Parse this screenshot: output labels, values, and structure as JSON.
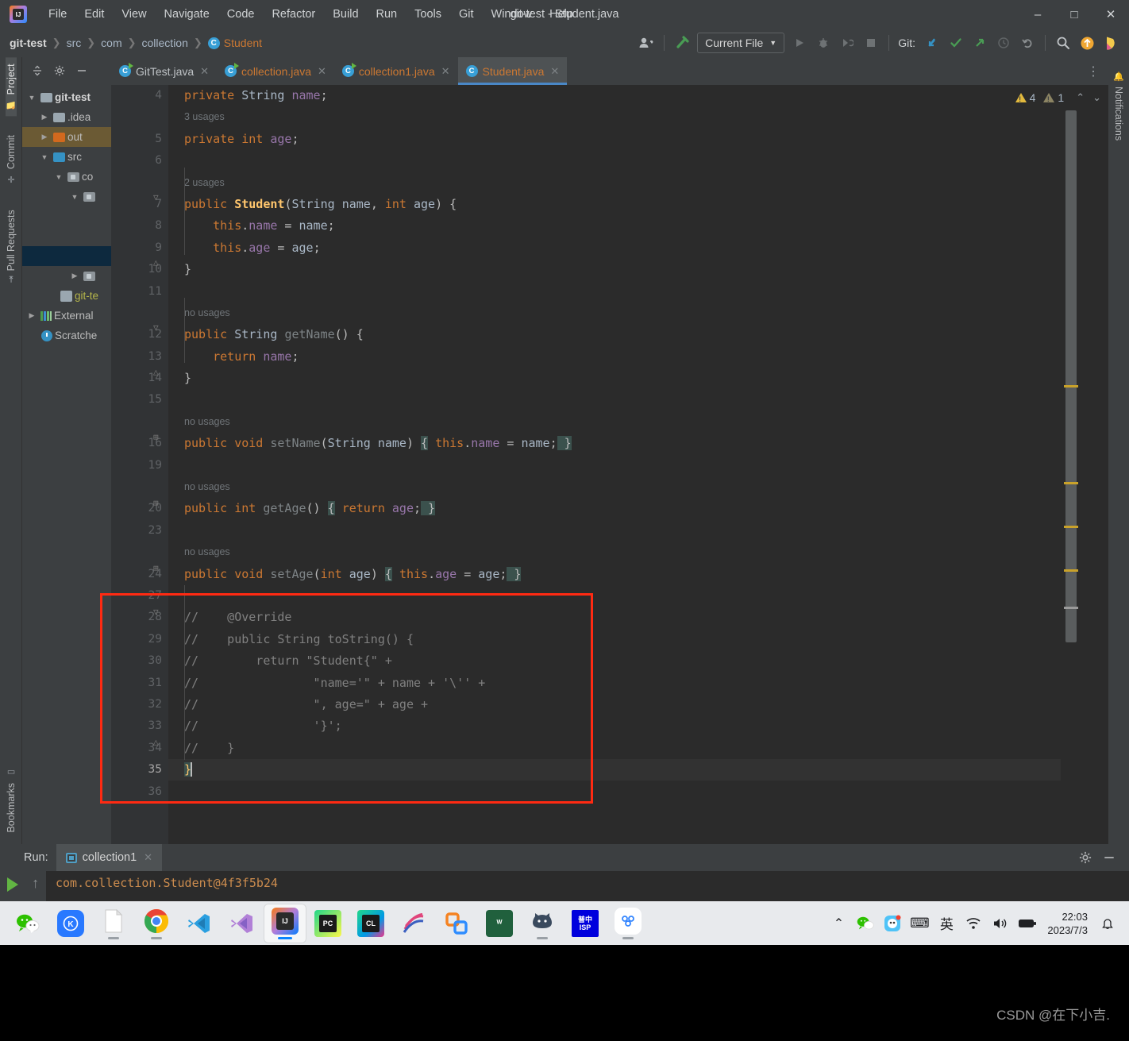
{
  "window": {
    "title": "git-test - Student.java",
    "minimize": "–",
    "maximize": "□",
    "close": "✕"
  },
  "menubar": {
    "items": [
      "File",
      "Edit",
      "View",
      "Navigate",
      "Code",
      "Refactor",
      "Build",
      "Run",
      "Tools",
      "Git",
      "Window",
      "Help"
    ]
  },
  "breadcrumb": {
    "items": [
      "git-test",
      "src",
      "com",
      "collection",
      "Student"
    ],
    "separator": "❯",
    "class_badge": "C"
  },
  "toolbar": {
    "run_config": "Current File",
    "git_label": "Git:",
    "icons": [
      "user-avatar-icon",
      "build-hammer-icon",
      "run-icon",
      "debug-icon",
      "run-coverage-icon",
      "stop-icon",
      "git-update-icon",
      "git-commit-icon",
      "git-push-icon",
      "git-history-icon",
      "git-rollback-icon",
      "search-everywhere-icon",
      "ide-update-icon",
      "ide-assistant-icon"
    ]
  },
  "left_tool_window_tabs": [
    {
      "label": "Project",
      "icon": "project-folder-icon",
      "active": true
    },
    {
      "label": "Commit",
      "icon": "commit-icon",
      "active": false
    },
    {
      "label": "Pull Requests",
      "icon": "pull-request-icon",
      "active": false
    }
  ],
  "bottom_tool_window_tabs": [
    {
      "label": "Bookmarks",
      "icon": "bookmark-icon"
    }
  ],
  "right_tool_window_tabs": [
    {
      "label": "Notifications",
      "icon": "notification-bell-icon"
    }
  ],
  "project_tree": [
    {
      "label": "git-test",
      "indent": 0,
      "arrow": "▾",
      "icon": "module-folder-icon",
      "bold": true,
      "state": "normal"
    },
    {
      "label": ".idea",
      "indent": 1,
      "arrow": "›",
      "icon": "folder-grey-icon",
      "bold": false,
      "state": "normal"
    },
    {
      "label": "out",
      "indent": 1,
      "arrow": "›",
      "icon": "folder-orange-icon",
      "bold": false,
      "state": "highlight-orange"
    },
    {
      "label": "src",
      "indent": 1,
      "arrow": "▾",
      "icon": "folder-blue-icon",
      "bold": false,
      "state": "normal"
    },
    {
      "label": "co",
      "indent": 2,
      "arrow": "▾",
      "icon": "package-icon",
      "bold": false,
      "state": "normal"
    },
    {
      "label": "",
      "indent": 3,
      "arrow": "▾",
      "icon": "package-icon",
      "bold": false,
      "state": "normal"
    },
    {
      "label": "",
      "indent": 3,
      "arrow": "",
      "icon": "",
      "bold": false,
      "state": "normal"
    },
    {
      "label": "",
      "indent": 3,
      "arrow": "",
      "icon": "",
      "bold": false,
      "state": "selected-blue"
    },
    {
      "label": "",
      "indent": 3,
      "arrow": "›",
      "icon": "package-icon",
      "bold": false,
      "state": "normal"
    },
    {
      "label": "git-te",
      "indent": 2,
      "arrow": "",
      "icon": "iml-file-icon",
      "bold": false,
      "state": "yellow"
    },
    {
      "label": "External",
      "indent": 0,
      "arrow": "›",
      "icon": "external-libraries-icon",
      "bold": false,
      "state": "normal"
    },
    {
      "label": "Scratche",
      "indent": 1,
      "arrow": "",
      "icon": "scratches-icon",
      "bold": false,
      "state": "normal"
    }
  ],
  "editor_tabs": [
    {
      "label": "GitTest.java",
      "icon": "java-runnable-class-icon",
      "active": false,
      "modified_color": "#bfc3c6"
    },
    {
      "label": "collection.java",
      "icon": "java-runnable-class-icon",
      "active": false,
      "modified_color": "#cc7832"
    },
    {
      "label": "collection1.java",
      "icon": "java-runnable-class-icon",
      "active": false,
      "modified_color": "#cc7832"
    },
    {
      "label": "Student.java",
      "icon": "java-class-icon",
      "active": true,
      "modified_color": "#cc7832"
    }
  ],
  "editor_toolbar": {
    "collapse_all_icon": "collapse-all-icon",
    "settings_icon": "gear-icon",
    "hide_icon": "minimize-icon",
    "more_icon": "more-vertical-icon"
  },
  "inspection_widget": {
    "warning_count": "4",
    "weak_warning_count": "1",
    "prev_label": "⌃",
    "next_label": "⌄"
  },
  "code": {
    "lines": [
      {
        "num": "4",
        "hint": "",
        "text": "private String name;",
        "fold": "",
        "type": "code"
      },
      {
        "num": "",
        "hint": "3 usages",
        "text": "",
        "fold": "",
        "type": "hint"
      },
      {
        "num": "5",
        "hint": "",
        "text": "private int age;",
        "fold": "",
        "type": "code"
      },
      {
        "num": "6",
        "hint": "",
        "text": "",
        "fold": "",
        "type": "code"
      },
      {
        "num": "",
        "hint": "2 usages",
        "text": "",
        "fold": "",
        "type": "hint"
      },
      {
        "num": "7",
        "hint": "",
        "text": "public Student(String name, int age) {",
        "fold": "▽",
        "type": "code"
      },
      {
        "num": "8",
        "hint": "",
        "text": "    this.name = name;",
        "fold": "",
        "type": "code"
      },
      {
        "num": "9",
        "hint": "",
        "text": "    this.age = age;",
        "fold": "",
        "type": "code"
      },
      {
        "num": "10",
        "hint": "",
        "text": "}",
        "fold": "△",
        "type": "code"
      },
      {
        "num": "11",
        "hint": "",
        "text": "",
        "fold": "",
        "type": "code"
      },
      {
        "num": "",
        "hint": "no usages",
        "text": "",
        "fold": "",
        "type": "hint"
      },
      {
        "num": "12",
        "hint": "",
        "text": "public String getName() {",
        "fold": "▽",
        "type": "code"
      },
      {
        "num": "13",
        "hint": "",
        "text": "    return name;",
        "fold": "",
        "type": "code"
      },
      {
        "num": "14",
        "hint": "",
        "text": "}",
        "fold": "△",
        "type": "code"
      },
      {
        "num": "15",
        "hint": "",
        "text": "",
        "fold": "",
        "type": "code"
      },
      {
        "num": "",
        "hint": "no usages",
        "text": "",
        "fold": "",
        "type": "hint"
      },
      {
        "num": "16",
        "hint": "",
        "text": "public void setName(String name) { this.name = name; }",
        "fold": "⊞",
        "type": "code"
      },
      {
        "num": "19",
        "hint": "",
        "text": "",
        "fold": "",
        "type": "code"
      },
      {
        "num": "",
        "hint": "no usages",
        "text": "",
        "fold": "",
        "type": "hint"
      },
      {
        "num": "20",
        "hint": "",
        "text": "public int getAge() { return age; }",
        "fold": "⊞",
        "type": "code"
      },
      {
        "num": "23",
        "hint": "",
        "text": "",
        "fold": "",
        "type": "code"
      },
      {
        "num": "",
        "hint": "no usages",
        "text": "",
        "fold": "",
        "type": "hint"
      },
      {
        "num": "24",
        "hint": "",
        "text": "public void setAge(int age) { this.age = age; }",
        "fold": "⊞",
        "type": "code"
      },
      {
        "num": "27",
        "hint": "",
        "text": "",
        "fold": "",
        "type": "code"
      },
      {
        "num": "28",
        "hint": "",
        "text": "//    @Override",
        "fold": "▽",
        "type": "comment"
      },
      {
        "num": "29",
        "hint": "",
        "text": "//    public String toString() {",
        "fold": "",
        "type": "comment"
      },
      {
        "num": "30",
        "hint": "",
        "text": "//        return \"Student{\" +",
        "fold": "",
        "type": "comment"
      },
      {
        "num": "31",
        "hint": "",
        "text": "//                \"name='\" + name + '\\'' +",
        "fold": "",
        "type": "comment"
      },
      {
        "num": "32",
        "hint": "",
        "text": "//                \", age=\" + age +",
        "fold": "",
        "type": "comment"
      },
      {
        "num": "33",
        "hint": "",
        "text": "//                '}';",
        "fold": "",
        "type": "comment"
      },
      {
        "num": "34",
        "hint": "",
        "text": "//    }",
        "fold": "△",
        "type": "comment"
      },
      {
        "num": "35",
        "hint": "",
        "text": "}",
        "fold": "",
        "type": "caret"
      },
      {
        "num": "36",
        "hint": "",
        "text": "",
        "fold": "",
        "type": "code"
      }
    ]
  },
  "run_panel": {
    "label": "Run:",
    "tab": "collection1",
    "tab_close": "✕",
    "settings_icon": "gear-icon",
    "hide_icon": "minimize-icon",
    "output": "com.collection.Student@4f3f5b24",
    "rerun_icon": "rerun-green-play-icon",
    "scroll_up_icon": "scroll-up-icon"
  },
  "taskbar": {
    "apps": [
      {
        "name": "wechat-icon",
        "label": "",
        "color": "#2dc100",
        "glyph": "",
        "dot": false,
        "active": false
      },
      {
        "name": "kugou-icon",
        "label": "K",
        "color": "#2979ff",
        "glyph": "K",
        "dot": false,
        "active": false
      },
      {
        "name": "file-explorer-icon",
        "label": "",
        "color": "#ffffff",
        "glyph": "",
        "dot": true,
        "active": false
      },
      {
        "name": "chrome-icon",
        "label": "",
        "color": "#ea4335",
        "glyph": "",
        "dot": true,
        "active": false
      },
      {
        "name": "vscode-icon",
        "label": "",
        "color": "#1f9cf0",
        "glyph": "",
        "dot": false,
        "active": false
      },
      {
        "name": "visual-studio-icon",
        "label": "",
        "color": "#8661c5",
        "glyph": "",
        "dot": false,
        "active": false
      },
      {
        "name": "intellij-idea-icon",
        "label": "IJ",
        "color": "#2b2b2b",
        "glyph": "IJ",
        "dot": true,
        "active": true
      },
      {
        "name": "pycharm-icon",
        "label": "PC",
        "color": "#21d789",
        "glyph": "PC",
        "dot": false,
        "active": false
      },
      {
        "name": "clion-icon",
        "label": "CL",
        "color": "#21d789",
        "glyph": "CL",
        "dot": false,
        "active": false
      },
      {
        "name": "navicat-icon",
        "label": "",
        "color": "#e0457b",
        "glyph": "",
        "dot": false,
        "active": false
      },
      {
        "name": "vmware-icon",
        "label": "",
        "color": "#f58220",
        "glyph": "",
        "dot": false,
        "active": false
      },
      {
        "name": "vmware-workstation-icon",
        "label": "W",
        "color": "#20603d",
        "glyph": "W",
        "dot": false,
        "active": false
      },
      {
        "name": "gitkraken-cat-icon",
        "label": "",
        "color": "#3a4a5e",
        "glyph": "",
        "dot": true,
        "active": false
      },
      {
        "name": "isp-icon",
        "label": "ISP",
        "color": "#0000dd",
        "glyph": "ISP",
        "dot": false,
        "active": false
      },
      {
        "name": "baidu-netdisk-icon",
        "label": "",
        "color": "#3385ff",
        "glyph": "",
        "dot": true,
        "active": false
      }
    ],
    "tray": [
      {
        "name": "show-hidden-icons-chevron",
        "glyph": "⌃"
      },
      {
        "name": "wechat-tray-icon",
        "glyph": ""
      },
      {
        "name": "sogou-input-tray-icon",
        "glyph": ""
      },
      {
        "name": "touch-keyboard-icon",
        "glyph": "⌨"
      },
      {
        "name": "ime-language-icon",
        "glyph": "英"
      },
      {
        "name": "wifi-icon",
        "glyph": "📶"
      },
      {
        "name": "volume-icon",
        "glyph": "🔊"
      },
      {
        "name": "battery-icon",
        "glyph": "🔋"
      }
    ],
    "clock_time": "22:03",
    "clock_date": "2023/7/3",
    "notification_icon": "notification-center-icon"
  },
  "watermark": "CSDN @在下小吉.",
  "colors": {
    "editor_bg": "#2b2b2b",
    "panel_bg": "#3c3f41",
    "accent_blue": "#4a88c7",
    "keyword_orange": "#cc7832",
    "string_green": "#6a8759",
    "field_purple": "#9876aa",
    "comment_grey": "#808080",
    "annotation_red": "#ff2a12",
    "warning_yellow": "#e2b93d"
  }
}
